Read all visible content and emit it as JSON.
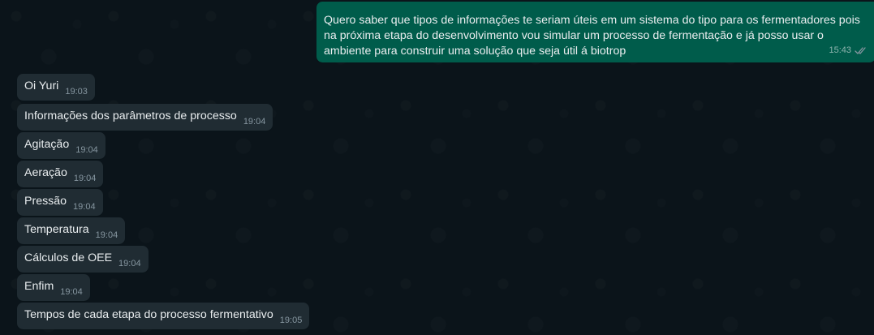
{
  "outgoing": {
    "text": "Quero saber que tipos de informações te seriam úteis em um sistema do tipo para os fermentadores pois na próxima etapa do desenvolvimento vou simular um processo de fermentação e já posso usar o ambiente para construir uma solução que seja útil á biotrop",
    "time": "15:43",
    "status_icon": "double-check-icon"
  },
  "messages": [
    {
      "text": "Oi Yuri",
      "time": "19:03"
    },
    {
      "text": "Informações dos parâmetros de processo",
      "time": "19:04"
    },
    {
      "text": "Agitação",
      "time": "19:04"
    },
    {
      "text": "Aeração",
      "time": "19:04"
    },
    {
      "text": "Pressão",
      "time": "19:04"
    },
    {
      "text": "Temperatura",
      "time": "19:04"
    },
    {
      "text": "Cálculos de OEE",
      "time": "19:04"
    },
    {
      "text": "Enfim",
      "time": "19:04"
    },
    {
      "text": "Tempos de cada etapa do processo fermentativo",
      "time": "19:05"
    }
  ],
  "colors": {
    "background": "#0b141a",
    "incoming_bubble": "#202c33",
    "outgoing_bubble": "#005c4b",
    "text": "#e9edef",
    "timestamp": "#8696a0",
    "read_ticks": "#8696a0"
  }
}
